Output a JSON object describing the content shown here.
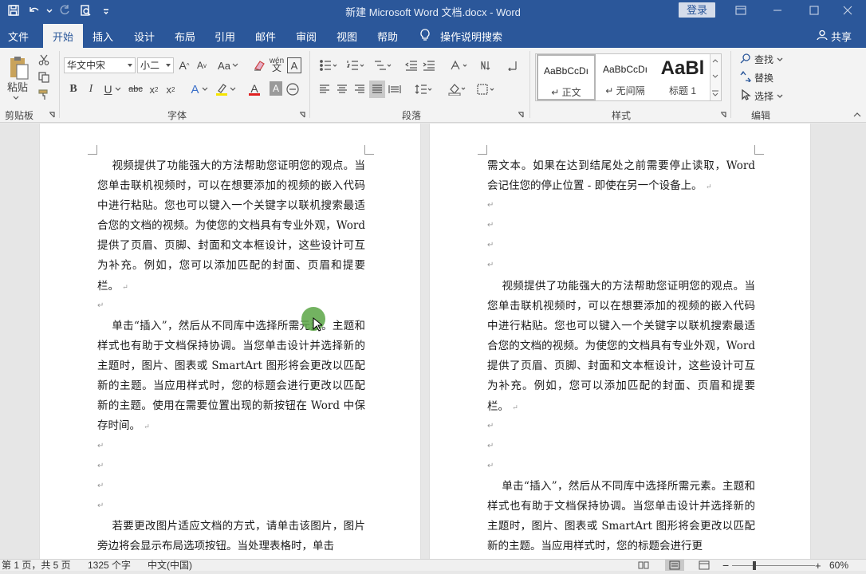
{
  "window": {
    "title": "新建 Microsoft Word 文档.docx  -  Word",
    "login_label": "登录"
  },
  "tabs": [
    {
      "label": "文件"
    },
    {
      "label": "开始"
    },
    {
      "label": "插入"
    },
    {
      "label": "设计"
    },
    {
      "label": "布局"
    },
    {
      "label": "引用"
    },
    {
      "label": "邮件"
    },
    {
      "label": "审阅"
    },
    {
      "label": "视图"
    },
    {
      "label": "帮助"
    }
  ],
  "active_tab": "开始",
  "tell_me": "操作说明搜索",
  "share_label": "共享",
  "ribbon": {
    "clipboard": {
      "paste_label": "粘贴",
      "group_label": "剪贴板"
    },
    "font": {
      "font_name": "华文中宋",
      "font_size": "小二",
      "group_label": "字体",
      "change_case": "Aa",
      "phonetic": "wén"
    },
    "paragraph": {
      "group_label": "段落"
    },
    "styles": {
      "group_label": "样式",
      "items": [
        {
          "sample": "AaBbCcDı",
          "name": "↵ 正文"
        },
        {
          "sample": "AaBbCcDı",
          "name": "↵ 无间隔"
        },
        {
          "sample": "AaBl",
          "name": "标题 1"
        }
      ]
    },
    "editing": {
      "find_label": "查找",
      "replace_label": "替换",
      "select_label": "选择",
      "group_label": "编辑"
    }
  },
  "document": {
    "page_left": [
      "    视频提供了功能强大的方法帮助您证明您的观点。当您单击联机视频时，可以在想要添加的视频的嵌入代码中进行粘贴。您也可以键入一个关键字以联机搜索最适合您的文档的视频。为使您的文档具有专业外观，Word 提供了页眉、页脚、封面和文本框设计，这些设计可互为补充。例如，您可以添加匹配的封面、页眉和提要栏。",
      "    单击“插入”，然后从不同库中选择所需元素。主题和样式也有助于文档保持协调。当您单击设计并选择新的主题时，图片、图表或 SmartArt 图形将会更改以匹配新的主题。当应用样式时，您的标题会进行更改以匹配新的主题。使用在需要位置出现的新按钮在 Word 中保存时间。",
      "    若要更改图片适应文档的方式，请单击该图片，图片旁边将会显示布局选项按钮。当处理表格时，单击"
    ],
    "page_right": [
      "需文本。如果在达到结尾处之前需要停止读取，Word 会记住您的停止位置 - 即使在另一个设备上。",
      "    视频提供了功能强大的方法帮助您证明您的观点。当您单击联机视频时，可以在想要添加的视频的嵌入代码中进行粘贴。您也可以键入一个关键字以联机搜索最适合您的文档的视频。为使您的文档具有专业外观，Word 提供了页眉、页脚、封面和文本框设计，这些设计可互为补充。例如，您可以添加匹配的封面、页眉和提要栏。",
      "    单击“插入”，然后从不同库中选择所需元素。主题和样式也有助于文档保持协调。当您单击设计并选择新的主题时，图片、图表或 SmartArt 图形将会更改以匹配新的主题。当应用样式时，您的标题会进行更"
    ],
    "para_mark": "↵"
  },
  "status": {
    "page": "第 1 页，共 5 页",
    "words": "1325 个字",
    "language": "中文(中国)",
    "zoom": "60%"
  }
}
